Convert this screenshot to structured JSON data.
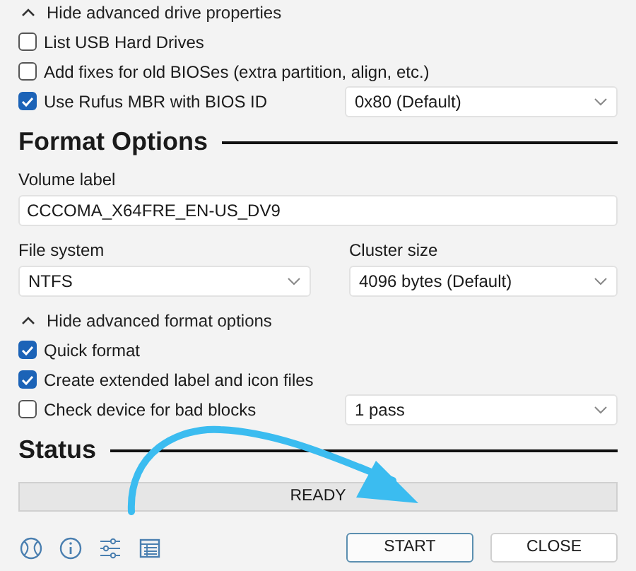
{
  "drive_properties": {
    "toggle": {
      "label": "Hide advanced drive properties",
      "expanded": true
    },
    "options": [
      {
        "label": "List USB Hard Drives",
        "checked": false
      },
      {
        "label": "Add fixes for old BIOSes (extra partition, align, etc.)",
        "checked": false
      },
      {
        "label": "Use Rufus MBR with BIOS ID",
        "checked": true,
        "dropdown": "0x80 (Default)"
      }
    ]
  },
  "format_options": {
    "heading": "Format Options",
    "volume_label": {
      "label": "Volume label",
      "value": "CCCOMA_X64FRE_EN-US_DV9"
    },
    "file_system": {
      "label": "File system",
      "value": "NTFS"
    },
    "cluster_size": {
      "label": "Cluster size",
      "value": "4096 bytes (Default)"
    },
    "toggle": {
      "label": "Hide advanced format options",
      "expanded": true
    },
    "options": [
      {
        "label": "Quick format",
        "checked": true
      },
      {
        "label": "Create extended label and icon files",
        "checked": true
      },
      {
        "label": "Check device for bad blocks",
        "checked": false,
        "dropdown": "1 pass"
      }
    ]
  },
  "status": {
    "heading": "Status",
    "text": "READY"
  },
  "toolbar": [
    {
      "kind": "globe"
    },
    {
      "kind": "info"
    },
    {
      "kind": "settings"
    },
    {
      "kind": "log"
    }
  ],
  "buttons": [
    {
      "label": "START",
      "kind": "primary"
    },
    {
      "label": "CLOSE",
      "kind": "secondary"
    }
  ]
}
